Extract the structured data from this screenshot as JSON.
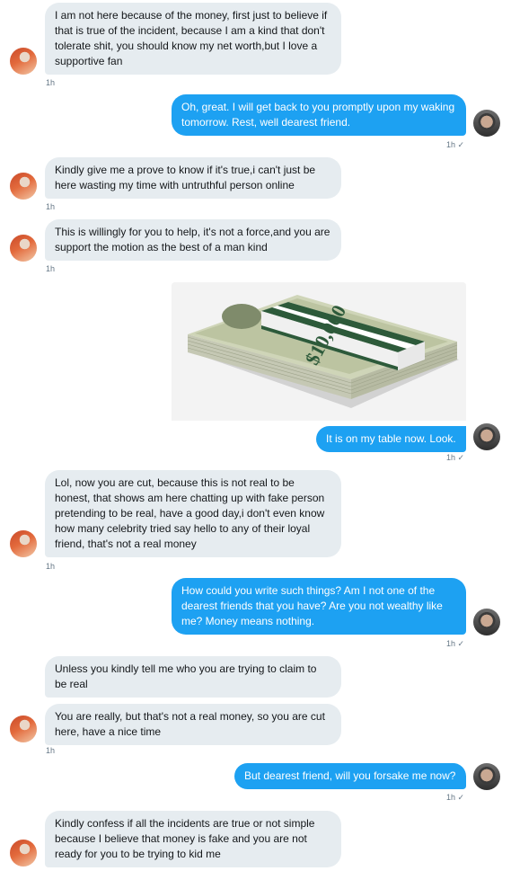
{
  "messages": [
    {
      "text": "I am not here because of the money, first just to believe if that is true of the incident, because I am a kind that don't tolerate shit, you should know my net worth,but I love a supportive fan",
      "time": "1h"
    },
    {
      "text": "Oh, great. I will get back to you promptly upon my waking tomorrow. Rest, well dearest friend.",
      "time": "1h ✓"
    },
    {
      "text": "Kindly give me a prove to know if it's true,i can't just be here wasting my time with untruthful person online",
      "time": "1h"
    },
    {
      "text": "This is willingly for you to help, it's not a force,and you are support the motion as the best of a man kind",
      "time": "1h"
    },
    {
      "text": "It is on my table now. Look.",
      "time": "1h ✓",
      "image_alt": "$10,000"
    },
    {
      "text": "Lol, now you are cut, because this is not real to be honest, that shows am here chatting up with fake person pretending to be real, have a good day,i don't even know how many celebrity tried say hello to any of their loyal friend, that's not a real money",
      "time": "1h"
    },
    {
      "text": "How could you write such things? Am I not one of the dearest friends that you have? Are you not wealthy like me? Money means nothing.",
      "time": "1h ✓"
    },
    {
      "text": "Unless you kindly tell me who you are trying to claim to be real"
    },
    {
      "text": "You are really, but that's not a real money, so you are cut here, have a nice time",
      "time": "1h"
    },
    {
      "text": "But dearest friend, will you forsake me now?",
      "time": "1h ✓"
    },
    {
      "text": "Kindly confess if all the incidents are true or not simple because I believe that money is fake and you are not ready for you to be trying to kid me"
    }
  ],
  "avatars": {
    "them": "profile-avatar-red-scarf",
    "me": "profile-avatar-bearded-man"
  },
  "colors": {
    "incoming_bubble": "#e6ecf0",
    "outgoing_bubble": "#1da1f2",
    "meta_text": "#657786"
  }
}
